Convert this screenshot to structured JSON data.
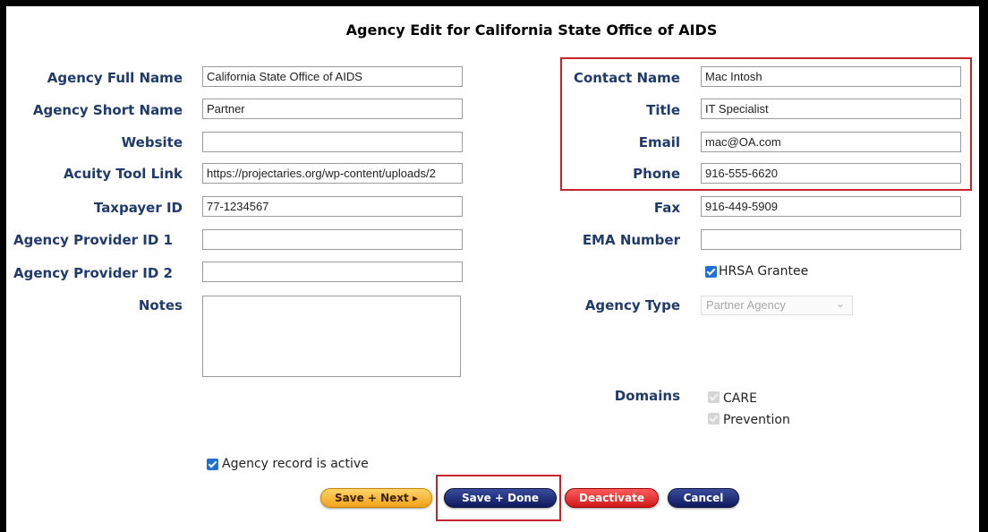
{
  "page": {
    "title": "Agency Edit for California State Office of AIDS"
  },
  "left_fields": [
    {
      "label": "Agency Full Name",
      "value": "California State Office of AIDS"
    },
    {
      "label": "Agency Short Name",
      "value": "Partner"
    },
    {
      "label": "Website",
      "value": ""
    },
    {
      "label": "Acuity Tool Link",
      "value": "https://projectaries.org/wp-content/uploads/2"
    },
    {
      "label": "Taxpayer ID",
      "value": "77-1234567"
    },
    {
      "label": "Agency Provider ID 1",
      "value": ""
    },
    {
      "label": "Agency Provider ID 2",
      "value": ""
    },
    {
      "label": "Notes",
      "value": ""
    }
  ],
  "right_fields": [
    {
      "label": "Contact Name",
      "value": "Mac Intosh"
    },
    {
      "label": "Title",
      "value": "IT Specialist"
    },
    {
      "label": "Email",
      "value": "mac@OA.com"
    },
    {
      "label": "Phone",
      "value": "916-555-6620"
    },
    {
      "label": "Fax",
      "value": "916-449-5909"
    },
    {
      "label": "EMA Number",
      "value": ""
    }
  ],
  "hrsa": {
    "label": "HRSA Grantee",
    "checked": true
  },
  "agency_type": {
    "label": "Agency Type",
    "selected": "Partner Agency"
  },
  "domains": {
    "label": "Domains",
    "items": [
      {
        "label": "CARE",
        "checked": true
      },
      {
        "label": "Prevention",
        "checked": true
      }
    ]
  },
  "active": {
    "label": "Agency record is active",
    "checked": true
  },
  "buttons": {
    "save_next": "Save + Next ▸",
    "save_done": "Save + Done",
    "deactivate": "Deactivate",
    "cancel": "Cancel"
  },
  "colors": {
    "label_text": "#1f3a6b",
    "highlight_box": "#c8232c",
    "checkbox": "#1f6fd6",
    "save_next": "#f0a21a",
    "save_done": "#0f1a5e",
    "deactivate": "#d11818",
    "cancel": "#0f1a5e"
  }
}
